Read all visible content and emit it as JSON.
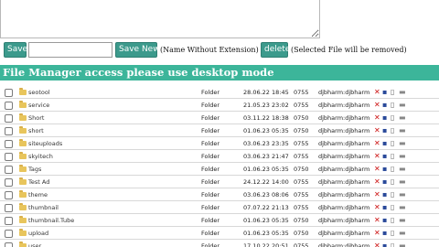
{
  "toolbar": {
    "save_label": "Save",
    "save_new_label": "Save New",
    "name_hint": "(Name Without Extension)",
    "delete_label": "delete",
    "delete_hint": "(Selected File will be removed)"
  },
  "banner": {
    "text": "File Manager access please use desktop mode"
  },
  "colors": {
    "button": "#3c9a8c",
    "banner": "#3cb59a",
    "folder": "#e8c55c",
    "delete_icon": "#cc1111"
  },
  "rows": [
    {
      "name": "seotool",
      "type": "Folder",
      "date": "28.06.22 18:45",
      "perm": "0755",
      "owner": "djbharm:djbharm"
    },
    {
      "name": "service",
      "type": "Folder",
      "date": "21.05.23 23:02",
      "perm": "0755",
      "owner": "djbharm:djbharm"
    },
    {
      "name": "Short",
      "type": "Folder",
      "date": "03.11.22 18:38",
      "perm": "0750",
      "owner": "djbharm:djbharm"
    },
    {
      "name": "short",
      "type": "Folder",
      "date": "01.06.23 05:35",
      "perm": "0750",
      "owner": "djbharm:djbharm"
    },
    {
      "name": "siteuploads",
      "type": "Folder",
      "date": "03.06.23 23:35",
      "perm": "0755",
      "owner": "djbharm:djbharm"
    },
    {
      "name": "skyitech",
      "type": "Folder",
      "date": "03.06.23 21:47",
      "perm": "0755",
      "owner": "djbharm:djbharm"
    },
    {
      "name": "Tags",
      "type": "Folder",
      "date": "01.06.23 05:35",
      "perm": "0750",
      "owner": "djbharm:djbharm"
    },
    {
      "name": "Test Ad",
      "type": "Folder",
      "date": "24.12.22 14:00",
      "perm": "0755",
      "owner": "djbharm:djbharm"
    },
    {
      "name": "theme",
      "type": "Folder",
      "date": "03.06.23 08:06",
      "perm": "0755",
      "owner": "djbharm:djbharm"
    },
    {
      "name": "thumbnail",
      "type": "Folder",
      "date": "07.07.22 21:13",
      "perm": "0755",
      "owner": "djbharm:djbharm"
    },
    {
      "name": "thumbnail.Tube",
      "type": "Folder",
      "date": "01.06.23 05:35",
      "perm": "0750",
      "owner": "djbharm:djbharm"
    },
    {
      "name": "upload",
      "type": "Folder",
      "date": "01.06.23 05:35",
      "perm": "0750",
      "owner": "djbharm:djbharm"
    },
    {
      "name": "user",
      "type": "Folder",
      "date": "17.10.22 20:51",
      "perm": "0755",
      "owner": "djbharm:djbharm"
    }
  ]
}
